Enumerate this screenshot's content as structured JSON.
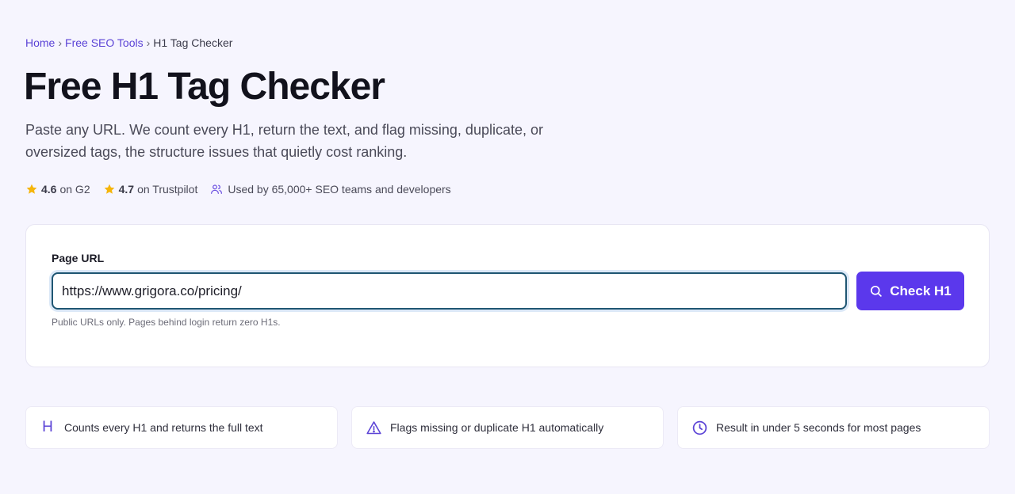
{
  "breadcrumb": {
    "items": [
      "Home",
      "Free SEO Tools",
      "H1 Tag Checker"
    ],
    "separator": "›"
  },
  "header": {
    "title": "Free H1 Tag Checker",
    "subtitle": "Paste any URL. We count every H1, return the text, and flag missing, duplicate, or oversized tags, the structure issues that quietly cost ranking."
  },
  "ratings": {
    "g2": {
      "score": "4.6",
      "label": "on G2",
      "icon": "star-icon"
    },
    "trustpilot": {
      "score": "4.7",
      "label": "on Trustpilot",
      "icon": "star-icon"
    },
    "users": {
      "text": "Used by 65,000+ SEO teams and developers",
      "icon": "users-icon"
    }
  },
  "form": {
    "label": "Page URL",
    "url_value": "https://www.grigora.co/pricing/",
    "button_label": "Check H1",
    "button_icon": "search-icon",
    "hint": "Public URLs only. Pages behind login return zero H1s."
  },
  "features": [
    {
      "icon": "h-letter-icon",
      "glyph": "H",
      "text": "Counts every H1 and returns the full text"
    },
    {
      "icon": "warning-triangle-icon",
      "text": "Flags missing or duplicate H1 automatically"
    },
    {
      "icon": "clock-icon",
      "text": "Result in under 5 seconds for most pages"
    }
  ],
  "colors": {
    "accent": "#5b38ec",
    "link": "#5b43d6",
    "star": "#f5b50a",
    "background": "#f6f5fe",
    "input_border": "#1f5672"
  }
}
